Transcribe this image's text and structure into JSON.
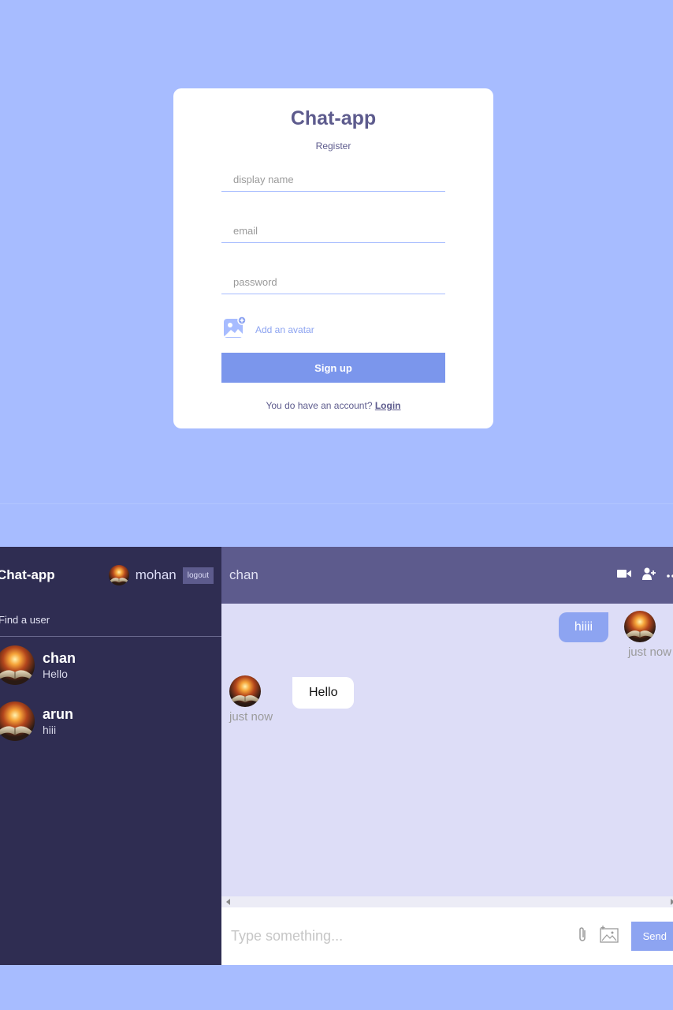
{
  "register": {
    "title": "Chat-app",
    "subtitle": "Register",
    "display_name_placeholder": "display name",
    "email_placeholder": "email",
    "password_placeholder": "password",
    "avatar_label": "Add an avatar",
    "submit_label": "Sign up",
    "login_prompt": "You do have an account?",
    "login_link": "Login"
  },
  "chat": {
    "brand": "Chat-app",
    "current_user": "mohan",
    "logout_label": "logout",
    "search_placeholder": "Find a user",
    "conversations": [
      {
        "name": "chan",
        "last_message": "Hello"
      },
      {
        "name": "arun",
        "last_message": "hiii"
      }
    ],
    "header_title": "chan",
    "header_icons": [
      "video-camera-icon",
      "add-user-icon",
      "more-icon"
    ],
    "messages": [
      {
        "owner": true,
        "text": "hiiii",
        "time": "just now"
      },
      {
        "owner": false,
        "text": "Hello",
        "time": "just now"
      }
    ],
    "input_placeholder": "Type something...",
    "send_label": "Send"
  },
  "colors": {
    "background": "#a7bcff",
    "sidebar": "#2f2d52",
    "header": "#5d5b8d",
    "chat_bg": "#ddddf7",
    "accent": "#8da4f1",
    "button": "#7b96ec"
  }
}
